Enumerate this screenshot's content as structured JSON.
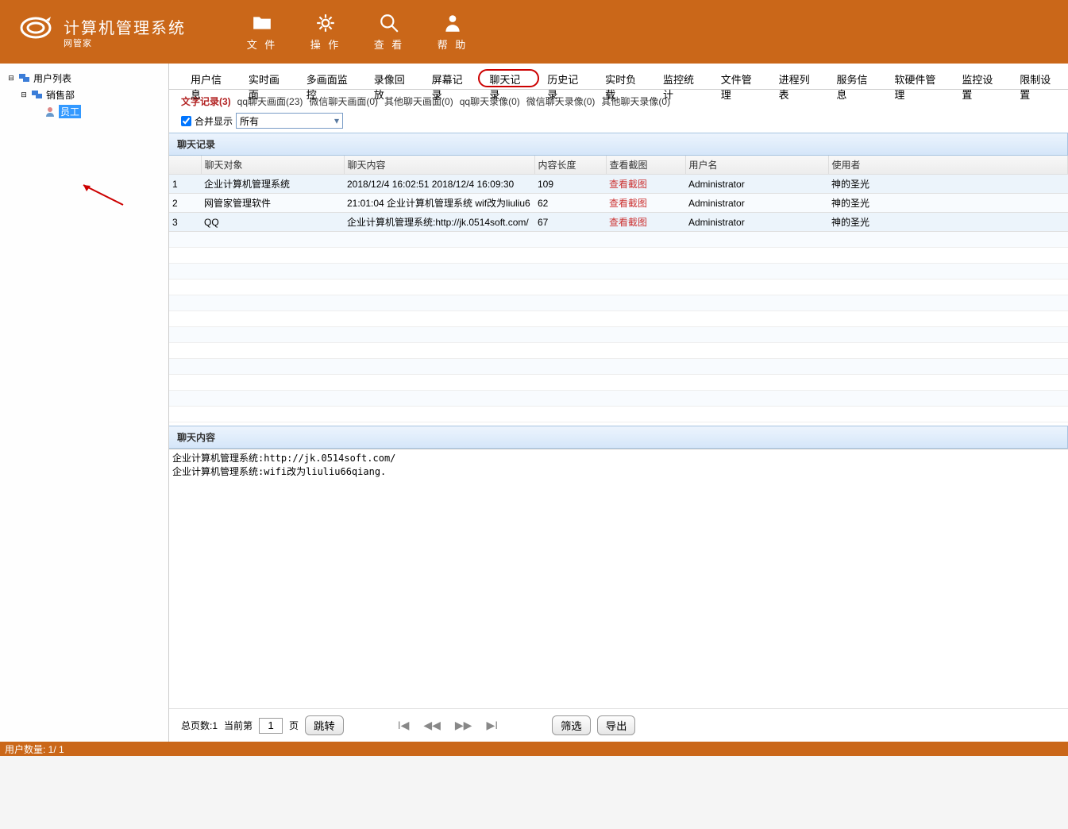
{
  "app": {
    "title": "计算机管理系统",
    "brand": "网管家"
  },
  "toolbar": [
    {
      "id": "file",
      "label": "文 件",
      "icon": "folder"
    },
    {
      "id": "operate",
      "label": "操 作",
      "icon": "gear"
    },
    {
      "id": "view",
      "label": "查 看",
      "icon": "search"
    },
    {
      "id": "help",
      "label": "帮 助",
      "icon": "user"
    }
  ],
  "sidebar": {
    "tree": [
      {
        "level": 0,
        "toggle": "−",
        "icon": "monitors",
        "label": "用户列表",
        "selected": false
      },
      {
        "level": 1,
        "toggle": "−",
        "icon": "monitors",
        "label": "销售部",
        "selected": false
      },
      {
        "level": 2,
        "toggle": "",
        "icon": "person",
        "label": "员工",
        "selected": true
      }
    ]
  },
  "tabs": [
    {
      "label": "用户信息",
      "circled": false
    },
    {
      "label": "实时画面",
      "circled": false
    },
    {
      "label": "多画面监控",
      "circled": false
    },
    {
      "label": "录像回放",
      "circled": false
    },
    {
      "label": "屏幕记录",
      "circled": false
    },
    {
      "label": "聊天记录",
      "circled": true
    },
    {
      "label": "历史记录",
      "circled": false
    },
    {
      "label": "实时负载",
      "circled": false
    },
    {
      "label": "监控统计",
      "circled": false
    },
    {
      "label": "文件管理",
      "circled": false
    },
    {
      "label": "进程列表",
      "circled": false
    },
    {
      "label": "服务信息",
      "circled": false
    },
    {
      "label": "软硬件管理",
      "circled": false
    },
    {
      "label": "监控设置",
      "circled": false
    },
    {
      "label": "限制设置",
      "circled": false
    }
  ],
  "subtabs": [
    {
      "label": "文字记录(3)",
      "active": true
    },
    {
      "label": "qq聊天画面(23)",
      "active": false
    },
    {
      "label": "微信聊天画面(0)",
      "active": false
    },
    {
      "label": "其他聊天画面(0)",
      "active": false
    },
    {
      "label": "qq聊天录像(0)",
      "active": false
    },
    {
      "label": "微信聊天录像(0)",
      "active": false
    },
    {
      "label": "其他聊天录像(0)",
      "active": false
    }
  ],
  "filter": {
    "mergeLabel": "合并显示",
    "selectValue": "所有"
  },
  "sections": {
    "recordHeader": "聊天记录",
    "contentHeader": "聊天内容"
  },
  "columns": {
    "idx": "",
    "target": "聊天对象",
    "content": "聊天内容",
    "length": "内容长度",
    "screenshot": "查看截图",
    "username": "用户名",
    "operator": "使用者"
  },
  "rows": [
    {
      "idx": "1",
      "target": "企业计算机管理系统",
      "content": "2018/12/4 16:02:51  2018/12/4 16:09:30",
      "length": "109",
      "screenshot": "查看截图",
      "username": "Administrator",
      "operator": "神的圣光"
    },
    {
      "idx": "2",
      "target": "网管家管理软件",
      "content": "21:01:04 企业计算机管理系统 wif改为liuliu6",
      "length": "62",
      "screenshot": "查看截图",
      "username": "Administrator",
      "operator": "神的圣光"
    },
    {
      "idx": "3",
      "target": "QQ",
      "content": "企业计算机管理系统:http://jk.0514soft.com/",
      "length": "67",
      "screenshot": "查看截图",
      "username": "Administrator",
      "operator": "神的圣光"
    }
  ],
  "detail": {
    "line1": "企业计算机管理系统:http://jk.0514soft.com/",
    "line2": "企业计算机管理系统:wifi改为liuliu66qiang."
  },
  "pager": {
    "totalLabel": "总页数:1",
    "currentLabel": "当前第",
    "pageValue": "1",
    "pageUnit": "页",
    "go": "跳转",
    "filter": "筛选",
    "export": "导出"
  },
  "status": "用户数量: 1/ 1"
}
